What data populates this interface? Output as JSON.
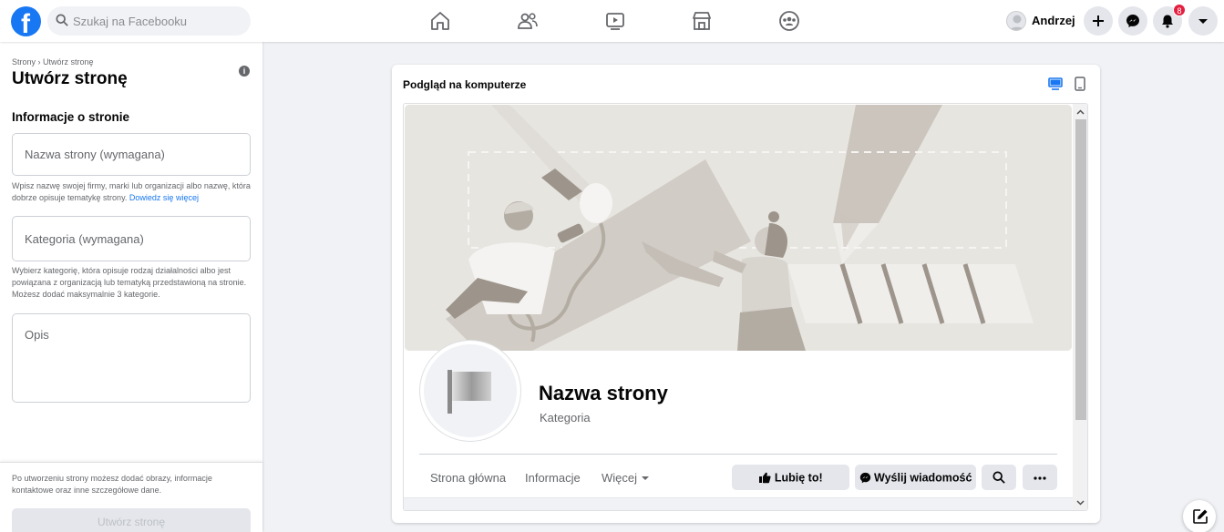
{
  "topbar": {
    "logo_letter": "f",
    "search_placeholder": "Szukaj na Facebooku",
    "nav_icons": [
      "home-icon",
      "friends-icon",
      "watch-icon",
      "marketplace-icon",
      "groups-icon"
    ],
    "user_name": "Andrzej",
    "notification_count": "8",
    "action_icons": [
      "plus-icon",
      "messenger-icon",
      "bell-icon",
      "caret-down-icon"
    ]
  },
  "left_panel": {
    "breadcrumb": "Strony › Utwórz stronę",
    "title": "Utwórz stronę",
    "section_heading": "Informacje o stronie",
    "name_field_placeholder": "Nazwa strony (wymagana)",
    "name_helper": "Wpisz nazwę swojej firmy, marki lub organizacji albo nazwę, która dobrze opisuje tematykę strony.",
    "name_helper_link": "Dowiedz się więcej",
    "category_field_placeholder": "Kategoria (wymagana)",
    "category_helper": "Wybierz kategorię, która opisuje rodzaj działalności albo jest powiązana z organizacją lub tematyką przedstawioną na stronie. Możesz dodać maksymalnie 3 kategorie.",
    "description_placeholder": "Opis",
    "bottom_note": "Po utworzeniu strony możesz dodać obrazy, informacje kontaktowe oraz inne szczegółowe dane.",
    "create_button": "Utwórz stronę"
  },
  "preview": {
    "title": "Podgląd na komputerze",
    "page_name": "Nazwa strony",
    "page_category": "Kategoria",
    "tabs": [
      "Strona główna",
      "Informacje",
      "Więcej"
    ],
    "like_button": "Lubię to!",
    "message_button": "Wyślij wiadomość",
    "colors": {
      "accent": "#1877f2",
      "badge": "#e41e3f"
    }
  }
}
